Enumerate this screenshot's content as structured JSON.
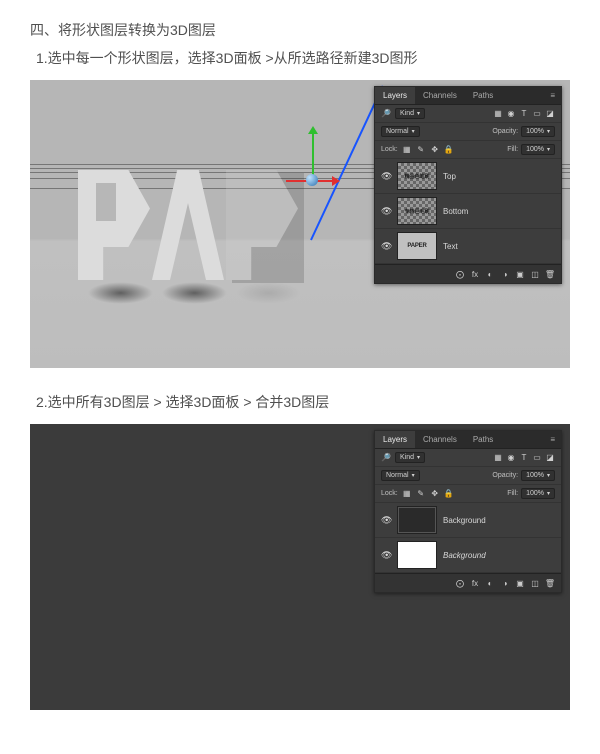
{
  "headings": {
    "h4": "四、将形状图层转换为3D图层",
    "step1": "1.选中每一个形状图层，选择3D面板 >从所选路径新建3D图形",
    "step2": "2.选中所有3D图层 > 选择3D面板 > 合并3D图层"
  },
  "panel": {
    "tabs": {
      "layers": "Layers",
      "channels": "Channels",
      "paths": "Paths"
    },
    "kindRow": {
      "filterLabel": "Kind",
      "icons": [
        "▦",
        "◉",
        "T",
        "▭",
        "◪"
      ]
    },
    "blendRow": {
      "mode": "Normal",
      "opacityLabel": "Opacity:",
      "opacity": "100%"
    },
    "lockRow": {
      "lockLabel": "Lock:",
      "lockIcons": [
        "▦",
        "✎",
        "✥",
        "🔒"
      ],
      "fillLabel": "Fill:",
      "fill": "100%"
    },
    "footerIcons": [
      "⨀",
      "fx",
      "◐",
      "◑",
      "▣",
      "◫",
      "🗑"
    ]
  },
  "shot1": {
    "layers": [
      {
        "thumbText": "精品色笔刷",
        "thumbClass": "checker",
        "name": "Top"
      },
      {
        "thumbText": "专转巨毛刷",
        "thumbClass": "checker",
        "name": "Bottom"
      },
      {
        "thumbText": "PAPER",
        "thumbClass": "paper",
        "name": "Text"
      }
    ]
  },
  "shot2": {
    "layers": [
      {
        "thumbText": "",
        "thumbClass": "dark",
        "name": "Background"
      },
      {
        "thumbText": "",
        "thumbClass": "white",
        "name": "Background",
        "italic": true
      }
    ]
  },
  "kindSearchGlyph": "🔎"
}
